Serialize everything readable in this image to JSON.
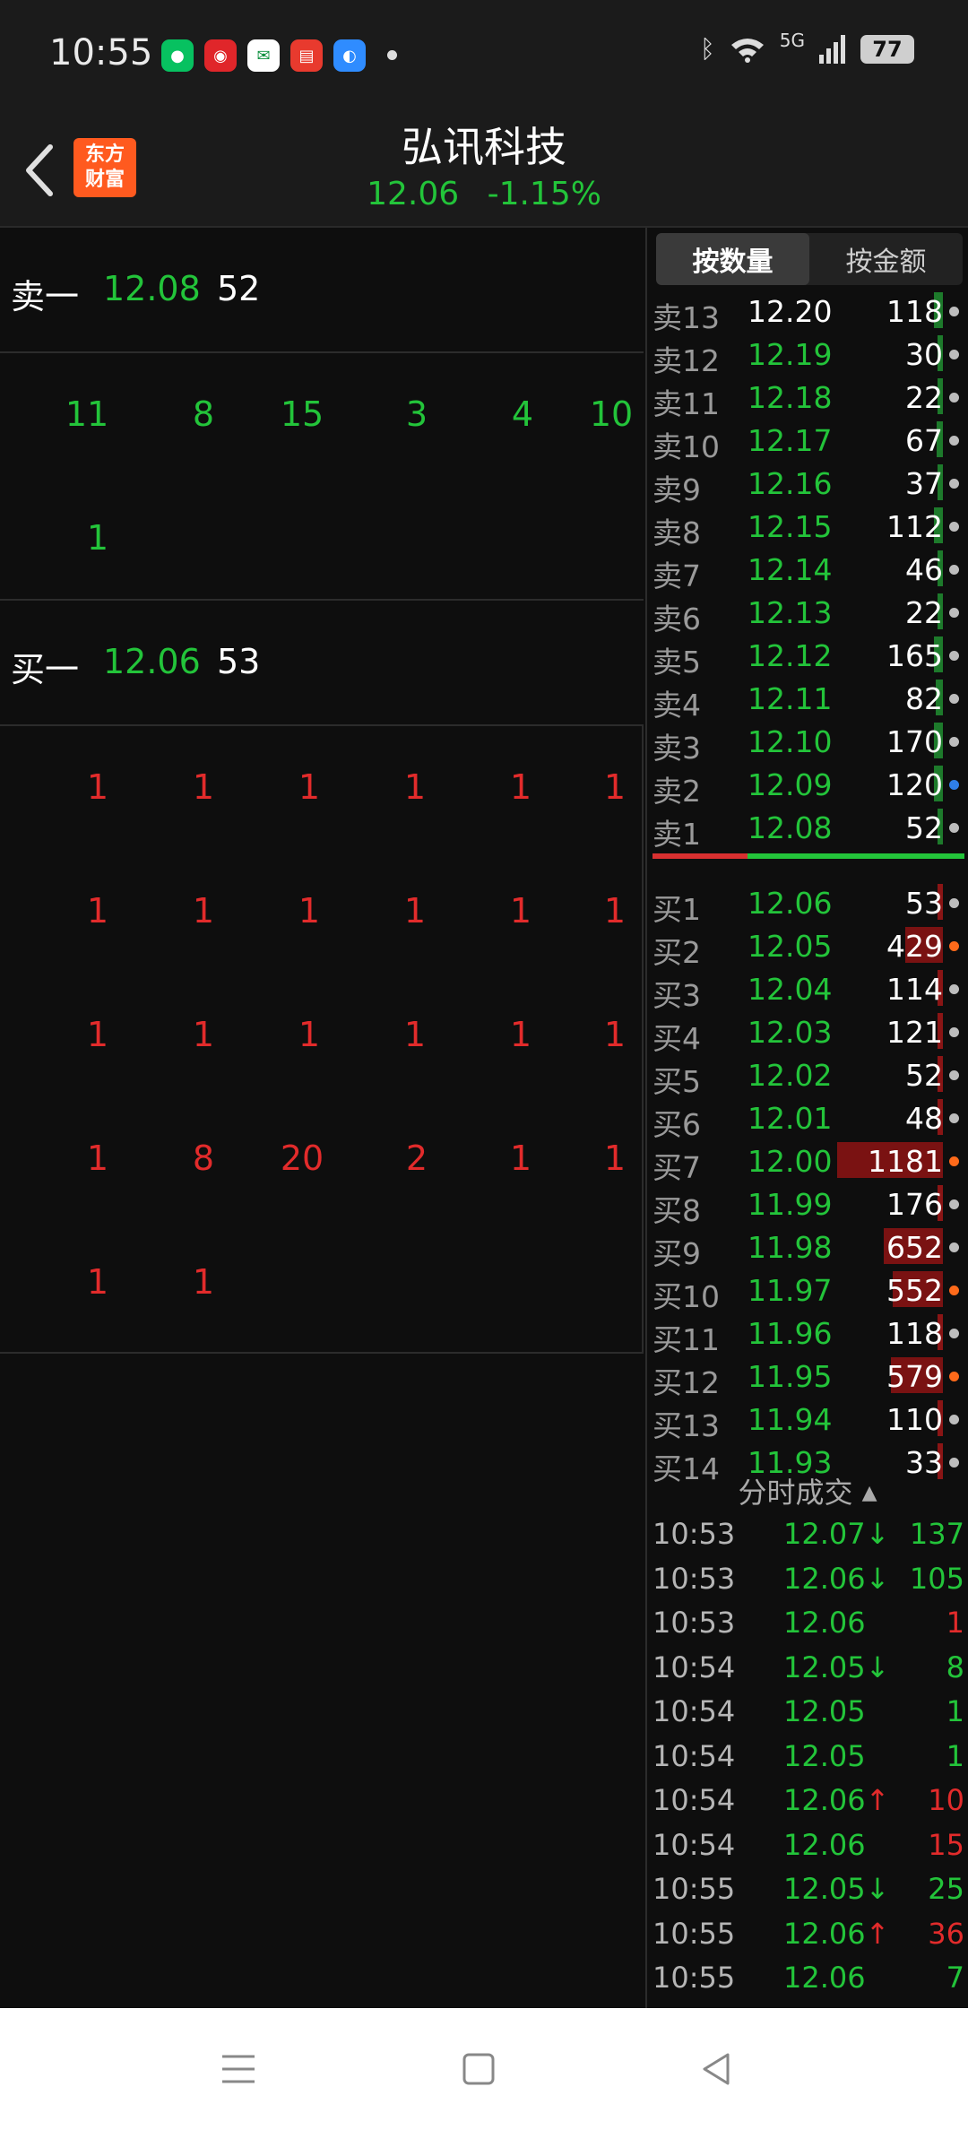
{
  "status": {
    "time": "10:55",
    "network": "5G",
    "battery": "77"
  },
  "header": {
    "title": "弘讯科技",
    "price": "12.06",
    "change": "-1.15%",
    "logo_line1": "东方",
    "logo_line2": "财富"
  },
  "left": {
    "sell1": {
      "label": "卖一",
      "price": "12.08",
      "vol": "52"
    },
    "sell_queue": [
      [
        "11",
        "8",
        "15",
        "3",
        "4",
        "10"
      ],
      [
        "1"
      ]
    ],
    "buy1": {
      "label": "买一",
      "price": "12.06",
      "vol": "53"
    },
    "buy_queue": [
      [
        "1",
        "1",
        "1",
        "1",
        "1",
        "1"
      ],
      [
        "1",
        "1",
        "1",
        "1",
        "1",
        "1"
      ],
      [
        "1",
        "1",
        "1",
        "1",
        "1",
        "1"
      ],
      [
        "1",
        "8",
        "20",
        "2",
        "1",
        "1"
      ],
      [
        "1",
        "1"
      ]
    ]
  },
  "tabs": [
    "按数量",
    "按金额"
  ],
  "sells": [
    {
      "label": "卖13",
      "price": "12.20",
      "vol": "118"
    },
    {
      "label": "卖12",
      "price": "12.19",
      "vol": "30"
    },
    {
      "label": "卖11",
      "price": "12.18",
      "vol": "22"
    },
    {
      "label": "卖10",
      "price": "12.17",
      "vol": "67"
    },
    {
      "label": "卖9",
      "price": "12.16",
      "vol": "37"
    },
    {
      "label": "卖8",
      "price": "12.15",
      "vol": "112"
    },
    {
      "label": "卖7",
      "price": "12.14",
      "vol": "46"
    },
    {
      "label": "卖6",
      "price": "12.13",
      "vol": "22"
    },
    {
      "label": "卖5",
      "price": "12.12",
      "vol": "165"
    },
    {
      "label": "卖4",
      "price": "12.11",
      "vol": "82"
    },
    {
      "label": "卖3",
      "price": "12.10",
      "vol": "170"
    },
    {
      "label": "卖2",
      "price": "12.09",
      "vol": "120"
    },
    {
      "label": "卖1",
      "price": "12.08",
      "vol": "52"
    }
  ],
  "buys": [
    {
      "label": "买1",
      "price": "12.06",
      "vol": "53"
    },
    {
      "label": "买2",
      "price": "12.05",
      "vol": "429"
    },
    {
      "label": "买3",
      "price": "12.04",
      "vol": "114"
    },
    {
      "label": "买4",
      "price": "12.03",
      "vol": "121"
    },
    {
      "label": "买5",
      "price": "12.02",
      "vol": "52"
    },
    {
      "label": "买6",
      "price": "12.01",
      "vol": "48"
    },
    {
      "label": "买7",
      "price": "12.00",
      "vol": "1181"
    },
    {
      "label": "买8",
      "price": "11.99",
      "vol": "176"
    },
    {
      "label": "买9",
      "price": "11.98",
      "vol": "652"
    },
    {
      "label": "买10",
      "price": "11.97",
      "vol": "552"
    },
    {
      "label": "买11",
      "price": "11.96",
      "vol": "118"
    },
    {
      "label": "买12",
      "price": "11.95",
      "vol": "579"
    },
    {
      "label": "买13",
      "price": "11.94",
      "vol": "110"
    },
    {
      "label": "买14",
      "price": "11.93",
      "vol": "33"
    }
  ],
  "trades_title": "分时成交",
  "trades": [
    {
      "time": "10:53",
      "price": "12.07↓",
      "vol": "137"
    },
    {
      "time": "10:53",
      "price": "12.06↓",
      "vol": "105"
    },
    {
      "time": "10:53",
      "price": "12.06",
      "vol": "1"
    },
    {
      "time": "10:54",
      "price": "12.05↓",
      "vol": "8"
    },
    {
      "time": "10:54",
      "price": "12.05",
      "vol": "1"
    },
    {
      "time": "10:54",
      "price": "12.05",
      "vol": "1"
    },
    {
      "time": "10:54",
      "price": "12.06↑",
      "vol": "10"
    },
    {
      "time": "10:54",
      "price": "12.06",
      "vol": "15"
    },
    {
      "time": "10:55",
      "price": "12.05↓",
      "vol": "25"
    },
    {
      "time": "10:55",
      "price": "12.06↑",
      "vol": "36"
    },
    {
      "time": "10:55",
      "price": "12.06",
      "vol": "7"
    }
  ]
}
